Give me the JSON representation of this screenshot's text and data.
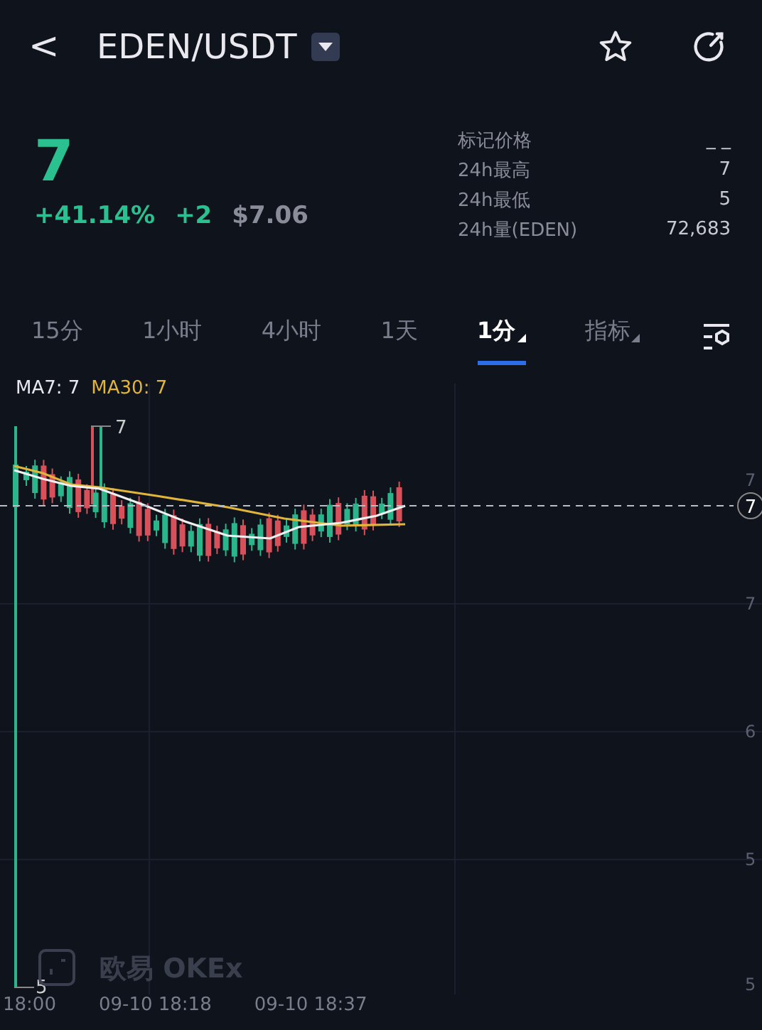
{
  "header": {
    "back": "<",
    "pair": "EDEN/USDT"
  },
  "price": {
    "last": "7",
    "change_pct": "+41.14%",
    "change": "+2",
    "usd": "$7.06"
  },
  "stats": [
    {
      "label": "标记价格",
      "value": "_ _"
    },
    {
      "label": "24h最高",
      "value": "7"
    },
    {
      "label": "24h最低",
      "value": "5"
    },
    {
      "label": "24h量(EDEN)",
      "value": "72,683"
    }
  ],
  "tabs": [
    {
      "label": "15分",
      "selected": false,
      "kind": "interval"
    },
    {
      "label": "1小时",
      "selected": false,
      "kind": "interval"
    },
    {
      "label": "4小时",
      "selected": false,
      "kind": "interval"
    },
    {
      "label": "1天",
      "selected": false,
      "kind": "interval"
    },
    {
      "label": "1分",
      "selected": true,
      "kind": "dropdown"
    },
    {
      "label": "指标",
      "selected": false,
      "kind": "dropdown"
    }
  ],
  "chart": {
    "ma7": "MA7: 7",
    "ma30": "MA30: 7",
    "high_marker": "7",
    "low_marker": "5",
    "current_price": "7",
    "y_labels": [
      "7",
      "7",
      "6",
      "5",
      "5"
    ],
    "x_labels": [
      "18:00",
      "09-10 18:18",
      "09-10 18:37"
    ],
    "watermark": "欧易 OKEx"
  }
}
